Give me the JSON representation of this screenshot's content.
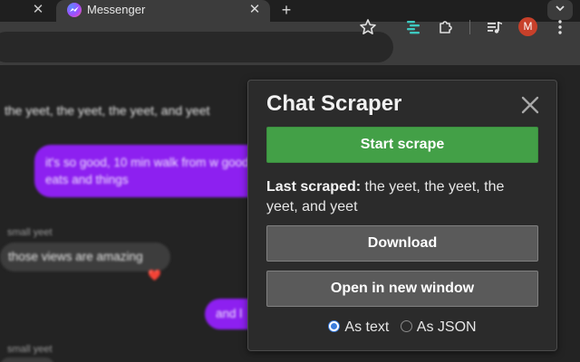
{
  "browser": {
    "tab": {
      "title": "Messenger"
    },
    "avatar_initial": "M",
    "new_tab_symbol": "+",
    "close_symbol": "✕"
  },
  "page": {
    "top_text": "the yeet, the yeet, the yeet, and yeet",
    "messages": [
      {
        "side": "right",
        "text": "it's so good, 10 min walk from w good eats and things"
      },
      {
        "side": "left",
        "sender": "small yeet",
        "text": "those views are amazing",
        "reaction": "❤️"
      },
      {
        "side": "right",
        "text": "and l"
      },
      {
        "side": "left",
        "sender": "small yeet"
      }
    ]
  },
  "popup": {
    "title": "Chat Scraper",
    "start_button": "Start scrape",
    "last_scraped_label": "Last scraped:",
    "last_scraped_value": "the yeet, the yeet, the yeet, and yeet",
    "download_button": "Download",
    "open_window_button": "Open in new window",
    "format_options": [
      {
        "label": "As text",
        "selected": true
      },
      {
        "label": "As JSON",
        "selected": false
      }
    ]
  },
  "colors": {
    "start_button": "#43a047",
    "secondary_button": "#5a5a5a",
    "messenger_bubble": "#8d20f0",
    "avatar": "#c8402a"
  }
}
